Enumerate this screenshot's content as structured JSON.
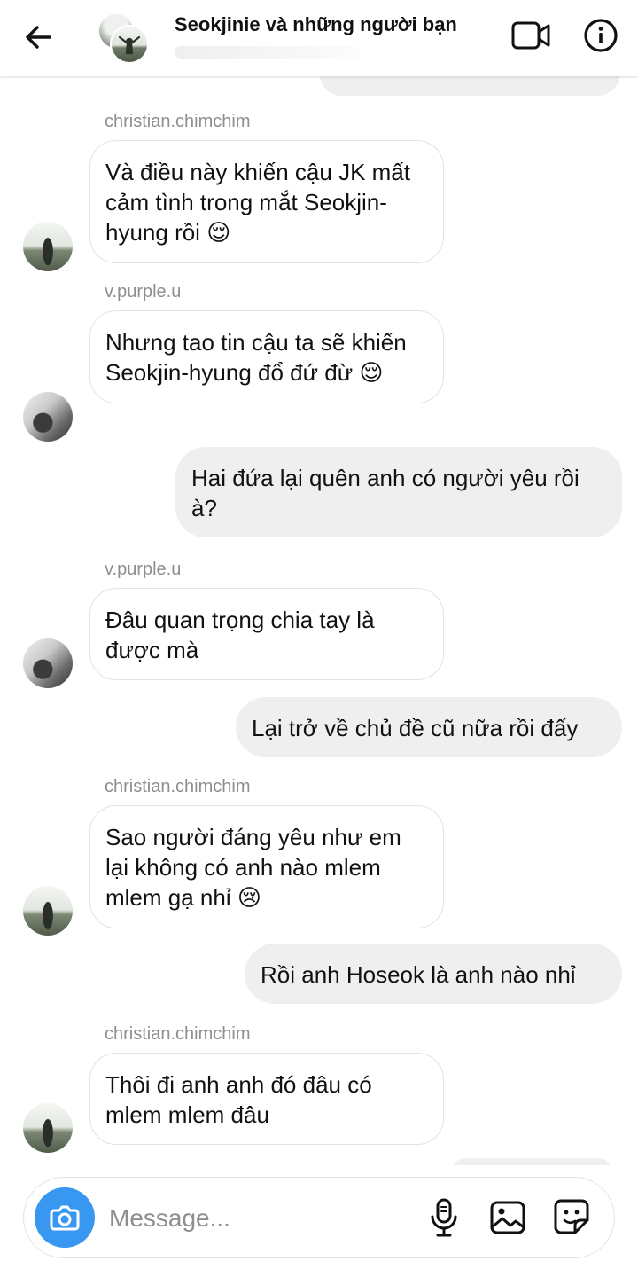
{
  "header": {
    "title": "Seokjinie và những người bạn",
    "icons": [
      "back-arrow-icon",
      "video-camera-icon",
      "info-icon"
    ]
  },
  "messages": [
    {
      "direction": "incoming",
      "sender": "christian.chimchim",
      "text": "Và điều này khiến cậu JK mất cảm tình trong mắt Seokjin-hyung rồi",
      "emoji": "😌"
    },
    {
      "direction": "incoming",
      "sender": "v.purple.u",
      "text": "Nhưng tao tin cậu ta sẽ khiến Seokjin-hyung đổ đứ đừ",
      "emoji": "😌"
    },
    {
      "direction": "outgoing",
      "text": "Hai đứa lại quên anh có người yêu rồi à?"
    },
    {
      "direction": "incoming",
      "sender": "v.purple.u",
      "text": "Đâu quan trọng chia tay là được mà"
    },
    {
      "direction": "outgoing",
      "text": "Lại trở về chủ đề cũ nữa rồi đấy"
    },
    {
      "direction": "incoming",
      "sender": "christian.chimchim",
      "text": "Sao người đáng yêu như em lại không có anh nào mlem mlem gạ nhỉ",
      "emoji": "😢"
    },
    {
      "direction": "outgoing",
      "text": "Rồi anh Hoseok là anh nào nhỉ"
    },
    {
      "direction": "incoming",
      "sender": "christian.chimchim",
      "text": "Thôi đi anh anh đó đâu có mlem mlem đâu"
    }
  ],
  "composer": {
    "placeholder": "Message...",
    "icons": [
      "camera-icon",
      "microphone-icon",
      "gallery-icon",
      "sticker-icon"
    ]
  },
  "colors": {
    "accent": "#3897f0",
    "outgoing_bubble": "#efefef",
    "incoming_border": "#e3e3e3",
    "sender_text": "#8e8e8e"
  }
}
